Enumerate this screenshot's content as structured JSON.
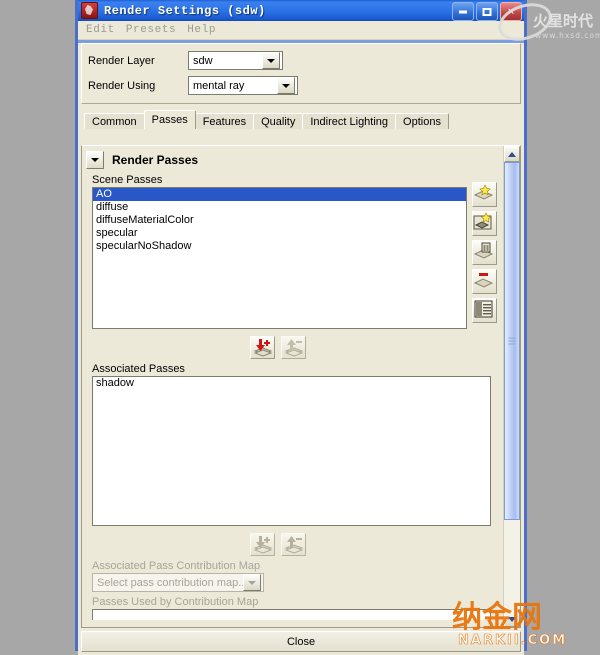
{
  "window": {
    "title": "Render Settings (sdw)",
    "app_icon": "maya-render-icon",
    "controls": {
      "minimize": "minimize-button",
      "maximize": "maximize-button",
      "close": "close-button"
    }
  },
  "menubar": {
    "items": [
      "Edit",
      "Presets",
      "Help"
    ]
  },
  "top_panel": {
    "render_layer": {
      "label": "Render Layer",
      "value": "sdw"
    },
    "render_using": {
      "label": "Render Using",
      "value": "mental ray"
    }
  },
  "tabs": [
    {
      "label": "Common",
      "active": false
    },
    {
      "label": "Passes",
      "active": true
    },
    {
      "label": "Features",
      "active": false
    },
    {
      "label": "Quality",
      "active": false
    },
    {
      "label": "Indirect Lighting",
      "active": false
    },
    {
      "label": "Options",
      "active": false
    }
  ],
  "frame": {
    "title": "Render Passes",
    "twisty": "collapse-arrow-icon"
  },
  "scene_passes": {
    "label": "Scene Passes",
    "items": [
      {
        "name": "AO",
        "selected": true
      },
      {
        "name": "diffuse",
        "selected": false
      },
      {
        "name": "diffuseMaterialColor",
        "selected": false
      },
      {
        "name": "specular",
        "selected": false
      },
      {
        "name": "specularNoShadow",
        "selected": false
      }
    ]
  },
  "pass_transfer_buttons": [
    {
      "name": "add-pass-button",
      "icon": "down-arrow-plus-icon",
      "enabled": true
    },
    {
      "name": "remove-pass-button",
      "icon": "up-arrow-minus-icon",
      "enabled": false
    }
  ],
  "associated_passes": {
    "label": "Associated Passes",
    "items": [
      {
        "name": "shadow",
        "selected": false
      }
    ]
  },
  "contribution_buttons": [
    {
      "name": "add-contribution-map-button",
      "icon": "down-arrow-plus-icon",
      "enabled": false
    },
    {
      "name": "remove-contribution-map-button",
      "icon": "up-arrow-minus-icon",
      "enabled": false
    }
  ],
  "contribution_map": {
    "label": "Associated Pass Contribution Map",
    "value": "Select pass contribution map...",
    "enabled": false
  },
  "passes_used": {
    "label": "Passes Used by Contribution Map"
  },
  "side_tools": [
    {
      "name": "create-new-pass-button",
      "icon": "new-pass-star-icon"
    },
    {
      "name": "create-pass-from-preset-button",
      "icon": "pass-preset-star-icon"
    },
    {
      "name": "duplicate-pass-button",
      "icon": "duplicate-pass-icon"
    },
    {
      "name": "delete-pass-button",
      "icon": "delete-pass-icon"
    },
    {
      "name": "pass-attributes-button",
      "icon": "pass-table-icon"
    }
  ],
  "scrollbar": {
    "up": "scroll-up-arrow",
    "down": "scroll-down-arrow",
    "thumb": "scroll-thumb"
  },
  "footer": {
    "close_label": "Close"
  },
  "watermarks": {
    "top_right": {
      "text": "www.hxsd.com",
      "brand": "火星时代",
      "color": "#e0e0e0"
    },
    "bottom_right": {
      "text": "NARKII.COM",
      "brand": "纳金网",
      "color": "#e8760d"
    }
  }
}
